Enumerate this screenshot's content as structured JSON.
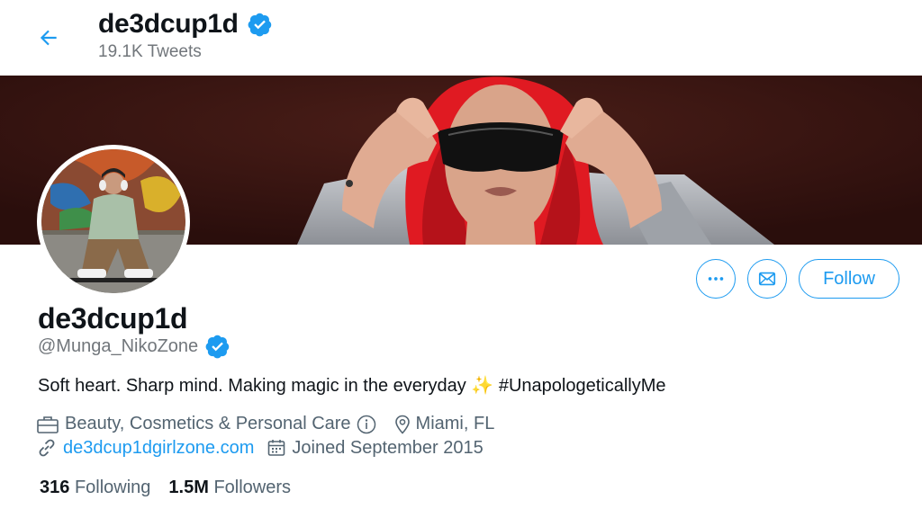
{
  "header": {
    "display_name": "de3dcup1d",
    "tweet_count": "19.1K Tweets"
  },
  "profile": {
    "display_name": "de3dcup1d",
    "handle": "@Munga_NikoZone",
    "bio_text": "Soft heart. Sharp mind. Making magic in the everyday",
    "bio_emoji": "✨",
    "bio_hashtag": "#UnapologeticallyMe",
    "category": "Beauty, Cosmetics & Personal Care",
    "location": "Miami, FL",
    "website": "de3dcup1dgirlzone.com",
    "joined": "Joined September 2015"
  },
  "actions": {
    "follow_label": "Follow"
  },
  "stats": {
    "following_count": "316",
    "following_label": "Following",
    "followers_count": "1.5M",
    "followers_label": "Followers"
  },
  "icons": {
    "back": "arrow-left-icon",
    "verified": "verified-badge-icon",
    "more": "more-dots-icon",
    "message": "envelope-icon",
    "category": "briefcase-icon",
    "info": "info-icon",
    "location": "location-pin-icon",
    "website": "link-icon",
    "joined": "calendar-icon"
  },
  "colors": {
    "accent": "#1d9bf0",
    "text": "#0f1419",
    "secondary": "#536471",
    "banner_bg": "#3a1512",
    "hair": "#e01a22"
  }
}
